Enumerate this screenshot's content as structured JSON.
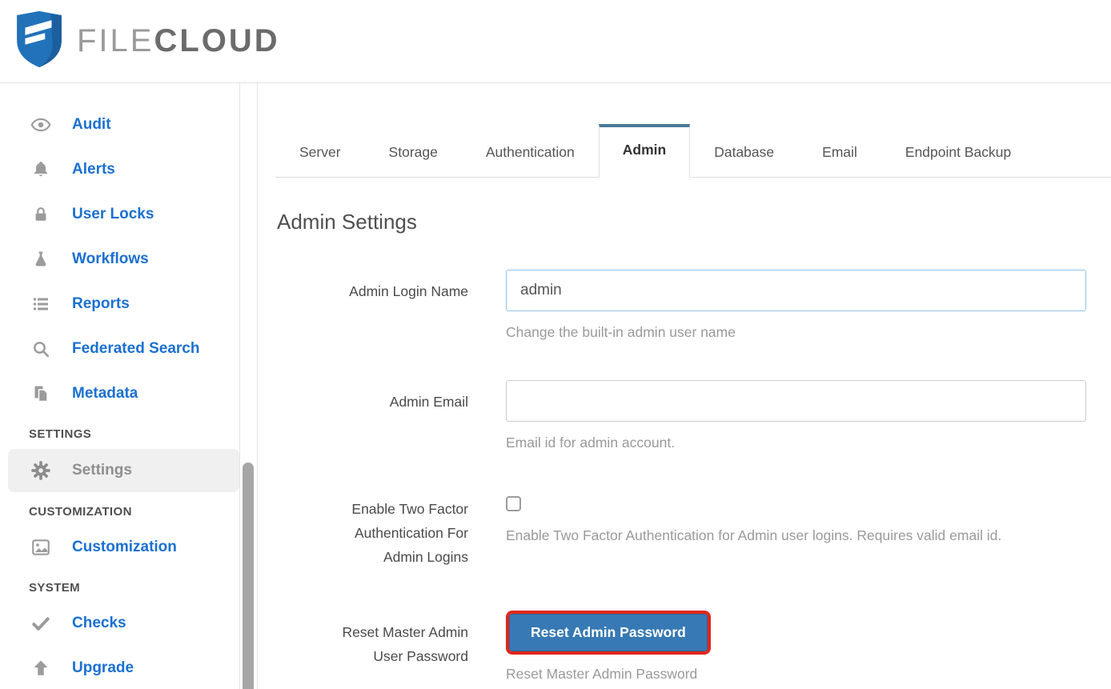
{
  "brand": {
    "name_light": "FILE",
    "name_dark": "CLOUD"
  },
  "sidebar": {
    "items": [
      {
        "label": "Audit",
        "icon": "eye-icon"
      },
      {
        "label": "Alerts",
        "icon": "bell-icon"
      },
      {
        "label": "User Locks",
        "icon": "lock-icon"
      },
      {
        "label": "Workflows",
        "icon": "flask-icon"
      },
      {
        "label": "Reports",
        "icon": "list-icon"
      },
      {
        "label": "Federated Search",
        "icon": "search-icon"
      },
      {
        "label": "Metadata",
        "icon": "copy-icon"
      }
    ],
    "settings_section": {
      "header": "SETTINGS",
      "settings_label": "Settings"
    },
    "customization_section": {
      "header": "CUSTOMIZATION",
      "customization_label": "Customization"
    },
    "system_section": {
      "header": "SYSTEM",
      "checks_label": "Checks",
      "upgrade_label": "Upgrade"
    }
  },
  "tabs": [
    {
      "label": "Server",
      "active": false
    },
    {
      "label": "Storage",
      "active": false
    },
    {
      "label": "Authentication",
      "active": false
    },
    {
      "label": "Admin",
      "active": true
    },
    {
      "label": "Database",
      "active": false
    },
    {
      "label": "Email",
      "active": false
    },
    {
      "label": "Endpoint Backup",
      "active": false
    }
  ],
  "page": {
    "title": "Admin Settings",
    "admin_login_name": {
      "label": "Admin Login Name",
      "value": "admin",
      "help": "Change the built-in admin user name"
    },
    "admin_email": {
      "label": "Admin Email",
      "value": "",
      "help": "Email id for admin account."
    },
    "two_factor": {
      "label": "Enable Two Factor\nAuthentication For\nAdmin Logins",
      "checked": false,
      "help": "Enable Two Factor Authentication for Admin user logins. Requires valid email id."
    },
    "reset_password": {
      "label": "Reset Master Admin\nUser Password",
      "button_label": "Reset Admin Password",
      "help": "Reset Master Admin Password"
    }
  },
  "colors": {
    "sidebar_link_blue": "#1b70d1",
    "tab_accent": "#4a7a96",
    "button_blue": "#3779b4",
    "annotation_red": "#e0261c",
    "logo_blue": "#2272b9",
    "active_item_bg": "#f0f0f0",
    "icon_gray": "#9b9b9b"
  }
}
